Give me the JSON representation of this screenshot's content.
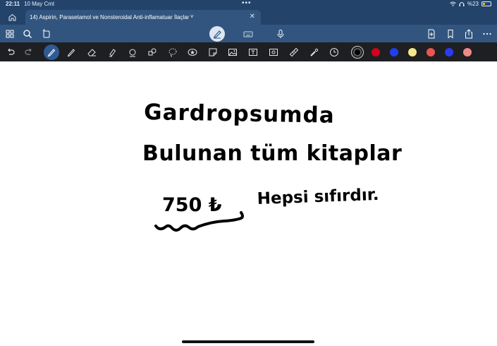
{
  "status_bar": {
    "time": "22:11",
    "date": "10 May Cmt",
    "battery": "%23",
    "battery_level": 0.23,
    "battery_color": "#f2c200",
    "icons": [
      "wifi-icon",
      "headphones-icon",
      "battery-icon"
    ]
  },
  "tab": {
    "title": "14) Aspirin, Parasetamol ve Nonsteroidal Anti-inflamatuar İlaçlar",
    "chevron": "˅",
    "close": "✕"
  },
  "toolbar": {
    "left_icons": [
      "grid-icon",
      "search-icon",
      "rotate-page-icon"
    ],
    "center_icons": [
      "pen-mode-icon",
      "keyboard-icon",
      "microphone-icon"
    ],
    "right_icons": [
      "add-page-icon",
      "bookmark-icon",
      "share-icon",
      "more-icon"
    ]
  },
  "tools": {
    "items": [
      "undo-icon",
      "redo-icon",
      "fountain-pen-icon",
      "pencil-icon",
      "eraser-icon",
      "highlighter-icon",
      "lasso-eraser-icon",
      "shapes-icon",
      "lasso-icon",
      "star-icon",
      "sticker-icon",
      "image-icon",
      "text-box-icon",
      "camera-icon",
      "ruler-icon",
      "laser-pointer-icon",
      "timer-icon"
    ],
    "colors": [
      "#000000",
      "#d0021b",
      "#1f3ff0",
      "#f5e68a",
      "#ef5350",
      "#2b3cf0",
      "#f08a8a"
    ]
  },
  "note": {
    "lines": [
      "Gardropsumda",
      "Bulunan tüm kitaplar",
      "750 ₺",
      "Hepsi sıfırdır."
    ],
    "ink_color": "#000000"
  }
}
